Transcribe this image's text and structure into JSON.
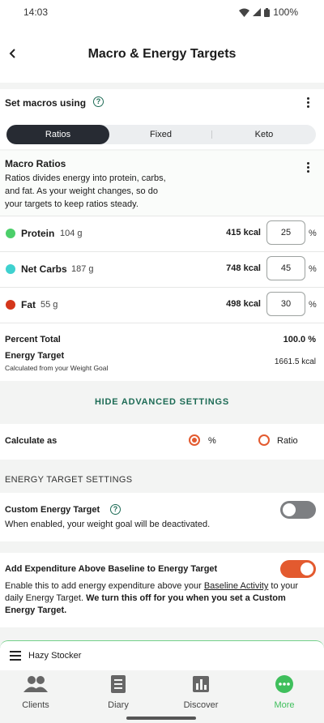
{
  "status": {
    "time": "14:03",
    "battery": "100%"
  },
  "header": {
    "title": "Macro & Energy Targets"
  },
  "set_macros": {
    "label": "Set macros using",
    "options": [
      "Ratios",
      "Fixed",
      "Keto"
    ],
    "selected": "Ratios"
  },
  "macro_ratios": {
    "title": "Macro Ratios",
    "description": "Ratios divides energy into protein, carbs, and fat. As your weight changes, so do your targets to keep ratios steady.",
    "rows": [
      {
        "name": "Protein",
        "grams": "104 g",
        "kcal": "415 kcal",
        "value": "25",
        "unit": "%",
        "color": "#4ccf6a"
      },
      {
        "name": "Net Carbs",
        "grams": "187 g",
        "kcal": "748 kcal",
        "value": "45",
        "unit": "%",
        "color": "#3fd1cf"
      },
      {
        "name": "Fat",
        "grams": "55 g",
        "kcal": "498 kcal",
        "value": "30",
        "unit": "%",
        "color": "#d4361b"
      }
    ],
    "percent_total_label": "Percent Total",
    "percent_total_value": "100.0 %",
    "energy_target_label": "Energy Target",
    "energy_target_sub": "Calculated from your Weight Goal",
    "energy_target_value": "1661.5 kcal"
  },
  "advanced": {
    "toggle_label": "HIDE ADVANCED SETTINGS"
  },
  "calculate_as": {
    "label": "Calculate as",
    "options": [
      "%",
      "Ratio"
    ],
    "selected": "%"
  },
  "energy_settings": {
    "section_title": "ENERGY TARGET SETTINGS",
    "custom": {
      "label": "Custom Energy Target",
      "description": "When enabled, your weight goal will be deactivated.",
      "enabled": false
    },
    "expenditure": {
      "label": "Add Expenditure Above Baseline to Energy Target",
      "desc_part1": "Enable this to add energy expenditure above your ",
      "desc_link": "Baseline Activity",
      "desc_part2": " to your daily Energy Target. ",
      "desc_bold": "We turn this off for you when you set a Custom Energy Target.",
      "enabled": true
    }
  },
  "user_bar": {
    "name": "Hazy Stocker"
  },
  "nav": {
    "items": [
      {
        "label": "Clients",
        "icon": "clients-icon"
      },
      {
        "label": "Diary",
        "icon": "diary-icon"
      },
      {
        "label": "Discover",
        "icon": "discover-icon"
      },
      {
        "label": "More",
        "icon": "more-icon"
      }
    ],
    "active": "More",
    "active_color": "#3fbf5c"
  },
  "colors": {
    "accent": "#e35a2f",
    "brand_green": "#1d6b55"
  }
}
